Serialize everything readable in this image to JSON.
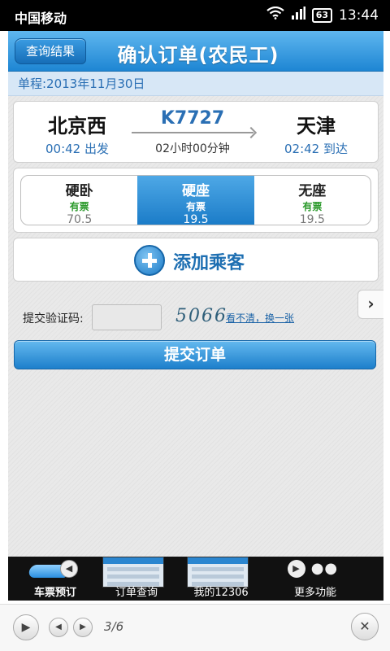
{
  "status_bar": {
    "carrier": "中国移动",
    "battery": "63",
    "time": "13:44"
  },
  "header": {
    "back_label": "查询结果",
    "title": "确认订单(农民工)"
  },
  "journey": {
    "label": "单程:2013年11月30日"
  },
  "trip": {
    "from_station": "北京西",
    "from_time": "00:42 出发",
    "train_no": "K7727",
    "duration": "02小时00分钟",
    "to_station": "天津",
    "to_time": "02:42 到达"
  },
  "seats": [
    {
      "name": "硬卧",
      "availability": "有票",
      "price": "70.5"
    },
    {
      "name": "硬座",
      "availability": "有票",
      "price": "19.5",
      "selected": true
    },
    {
      "name": "无座",
      "availability": "有票",
      "price": "19.5"
    }
  ],
  "add_passenger": {
    "label": "添加乘客"
  },
  "side_tab": {
    "label": "›"
  },
  "captcha": {
    "label": "提交验证码:",
    "input_value": "",
    "code": "5066",
    "refresh_label": "看不清，换一张"
  },
  "submit": {
    "label": "提交订单"
  },
  "bottom_nav": [
    {
      "label": "车票预订",
      "active": true
    },
    {
      "label": "订单查询"
    },
    {
      "label": "我的12306"
    },
    {
      "label": "更多功能"
    }
  ],
  "viewer": {
    "page": "3/6"
  },
  "colors": {
    "brand_blue": "#1e86d3",
    "available_green": "#2c9a2c",
    "link_blue": "#1a62a6"
  },
  "icons": [
    "wifi-icon",
    "signal-icon",
    "battery-icon",
    "plus-icon",
    "chevron-right-icon",
    "train-icon",
    "play-icon",
    "prev-icon",
    "next-icon",
    "close-icon"
  ]
}
